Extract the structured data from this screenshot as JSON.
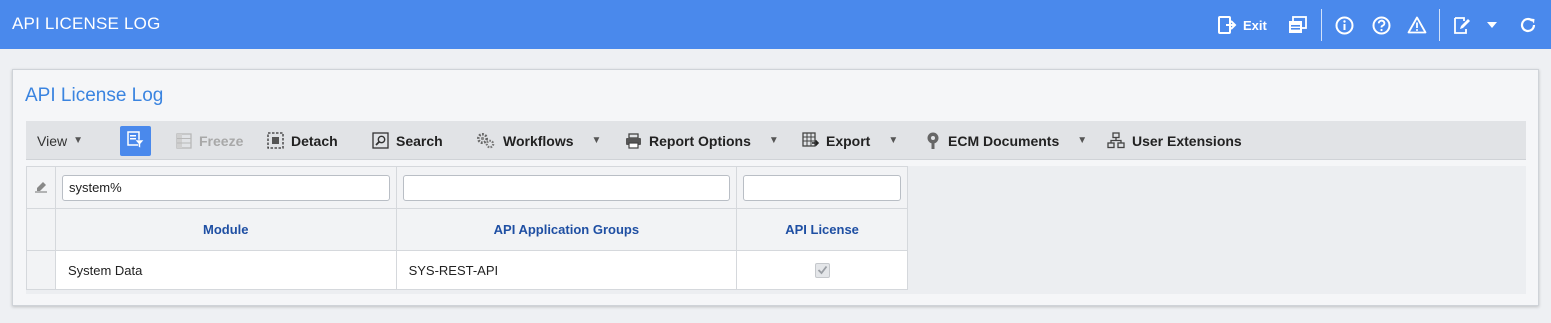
{
  "header": {
    "title": "API LICENSE LOG",
    "exit_label": "Exit"
  },
  "panel": {
    "title": "API License Log"
  },
  "toolbar": {
    "view": "View",
    "freeze": "Freeze",
    "detach": "Detach",
    "search": "Search",
    "workflows": "Workflows",
    "report_options": "Report Options",
    "export": "Export",
    "ecm_documents": "ECM Documents",
    "user_extensions": "User Extensions"
  },
  "grid": {
    "filters": [
      "system%",
      "",
      ""
    ],
    "columns": [
      "Module",
      "API Application Groups",
      "API License"
    ],
    "rows": [
      {
        "module": "System Data",
        "groups": "SYS-REST-API",
        "license_checked": true
      }
    ]
  },
  "colors": {
    "header_bg": "#4a89ec",
    "title_blue": "#3a84e0",
    "column_header": "#1f4fa3"
  }
}
